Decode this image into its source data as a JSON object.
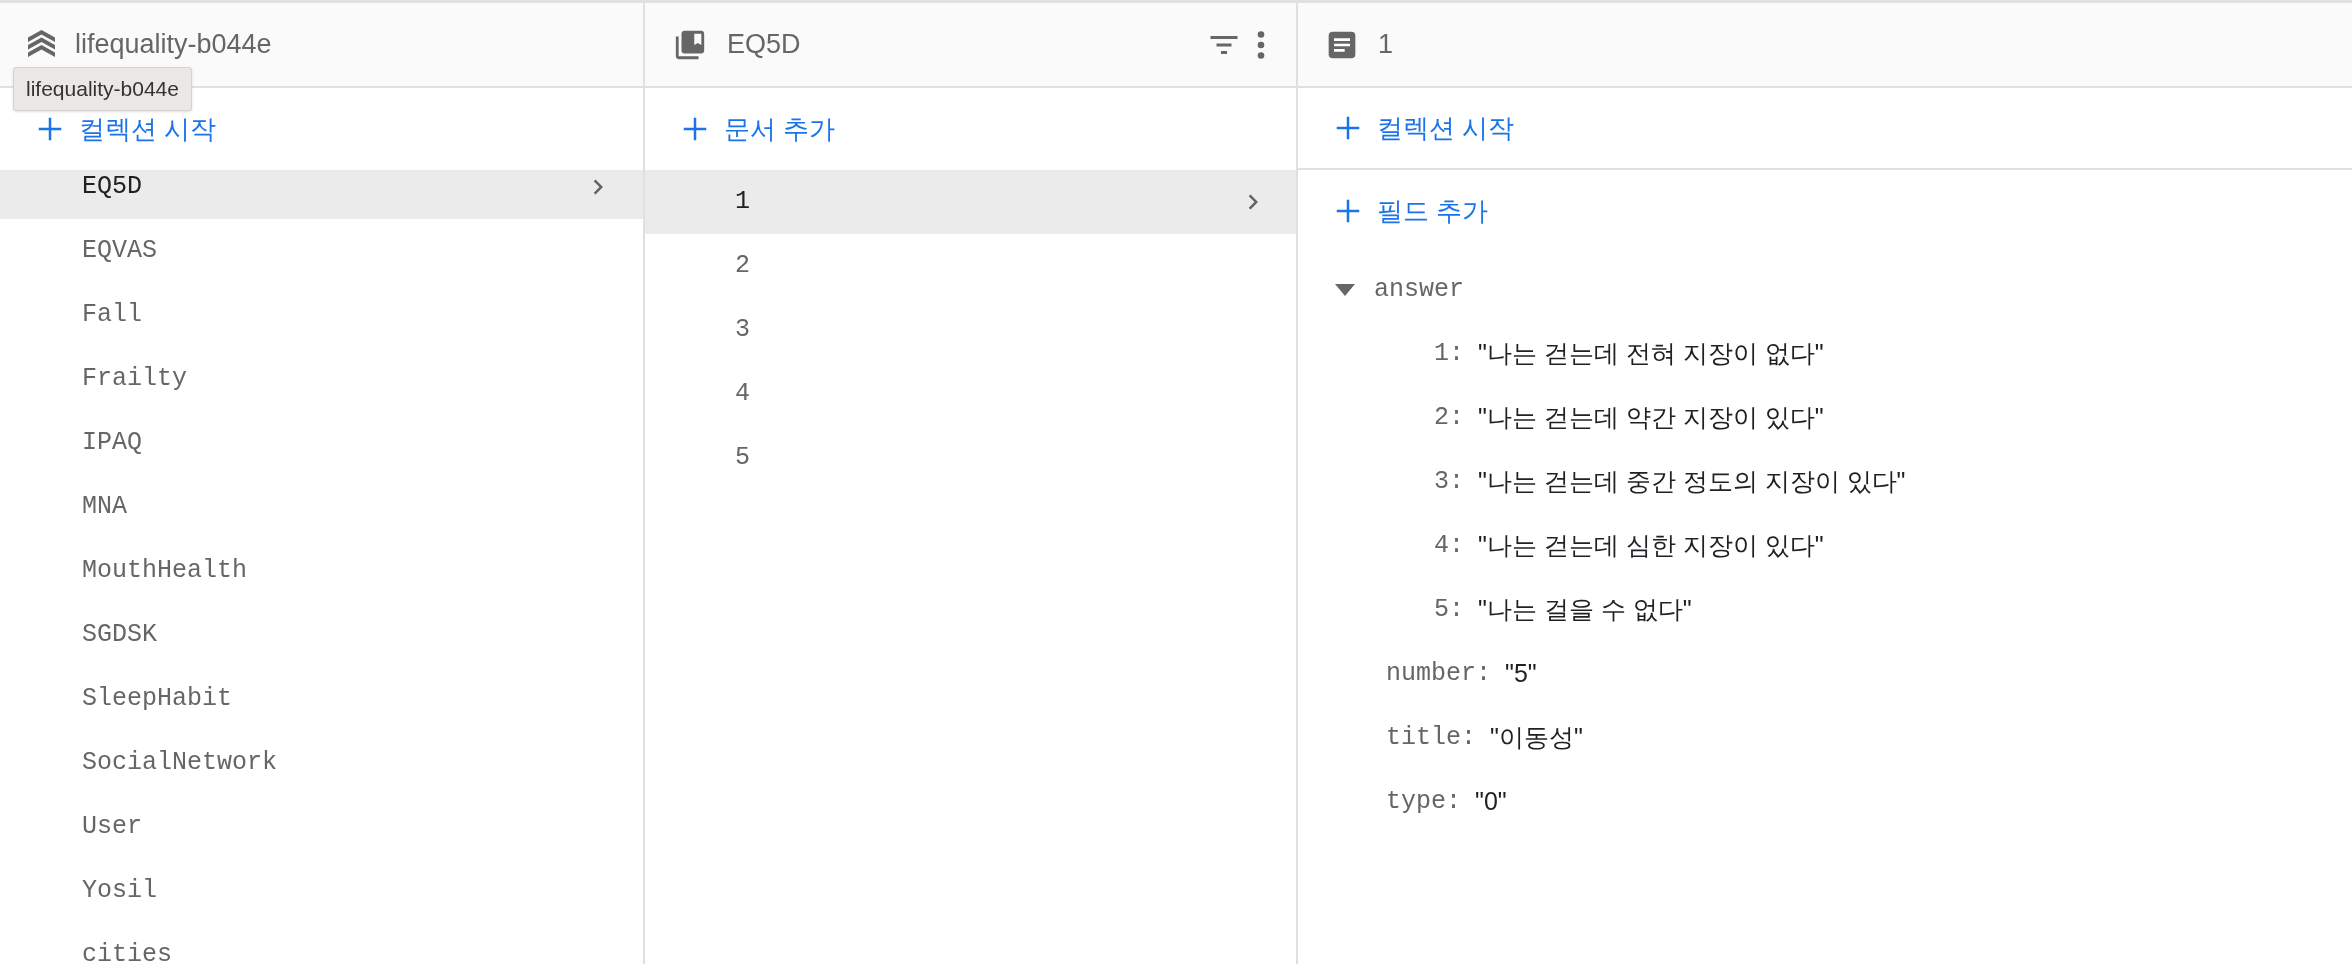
{
  "collections_panel": {
    "title": "lifequality-b044e",
    "tooltip": "lifequality-b044e",
    "action": "컬렉션 시작",
    "items": [
      {
        "label": "EQ5D",
        "selected": true
      },
      {
        "label": "EQVAS",
        "selected": false
      },
      {
        "label": "Fall",
        "selected": false
      },
      {
        "label": "Frailty",
        "selected": false
      },
      {
        "label": "IPAQ",
        "selected": false
      },
      {
        "label": "MNA",
        "selected": false
      },
      {
        "label": "MouthHealth",
        "selected": false
      },
      {
        "label": "SGDSK",
        "selected": false
      },
      {
        "label": "SleepHabit",
        "selected": false
      },
      {
        "label": "SocialNetwork",
        "selected": false
      },
      {
        "label": "User",
        "selected": false
      },
      {
        "label": "Yosil",
        "selected": false
      },
      {
        "label": "cities",
        "selected": false
      }
    ]
  },
  "documents_panel": {
    "title": "EQ5D",
    "action": "문서 추가",
    "items": [
      {
        "label": "1",
        "selected": true
      },
      {
        "label": "2",
        "selected": false
      },
      {
        "label": "3",
        "selected": false
      },
      {
        "label": "4",
        "selected": false
      },
      {
        "label": "5",
        "selected": false
      }
    ]
  },
  "document_panel": {
    "title": "1",
    "actions": [
      "컬렉션 시작",
      "필드 추가"
    ],
    "fields": [
      {
        "key": "answer",
        "expanded": true,
        "children": [
          {
            "key": "1:",
            "value": "\"나는 걷는데 전혀 지장이 없다\""
          },
          {
            "key": "2:",
            "value": "\"나는 걷는데 약간 지장이 있다\""
          },
          {
            "key": "3:",
            "value": "\"나는 걷는데 중간 정도의 지장이 있다\""
          },
          {
            "key": "4:",
            "value": "\"나는 걷는데 심한 지장이 있다\""
          },
          {
            "key": "5:",
            "value": "\"나는 걸을 수 없다\""
          }
        ]
      },
      {
        "key": "number:",
        "value": "\"5\""
      },
      {
        "key": "title:",
        "value": "\"이동성\""
      },
      {
        "key": "type:",
        "value": "\"0\""
      }
    ]
  }
}
